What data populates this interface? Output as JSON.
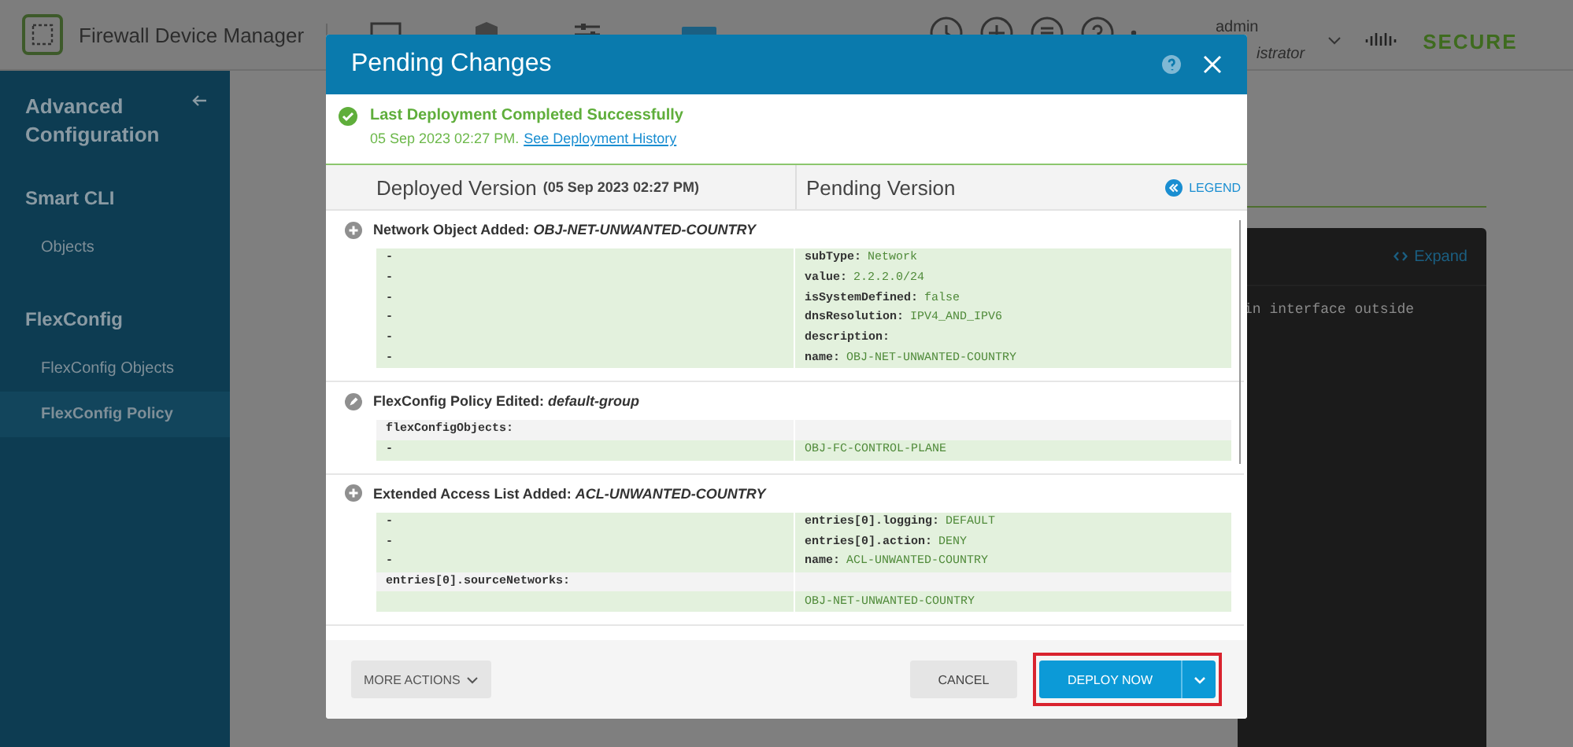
{
  "app": {
    "title": "Firewall Device Manager",
    "user": "admin",
    "role": "istrator",
    "brand": "SECURE"
  },
  "sidebar": {
    "title": "Advanced Configuration",
    "groups": [
      {
        "label": "Smart CLI",
        "items": [
          {
            "label": "Objects",
            "selected": false
          }
        ]
      },
      {
        "label": "FlexConfig",
        "items": [
          {
            "label": "FlexConfig Objects",
            "selected": false
          },
          {
            "label": "FlexConfig Policy",
            "selected": true
          }
        ]
      }
    ]
  },
  "background_panel": {
    "expand": "Expand",
    "code": "in interface outside"
  },
  "dialog": {
    "title": "Pending Changes",
    "status": {
      "title": "Last Deployment Completed Successfully",
      "date": "05 Sep 2023 02:27 PM.",
      "link": "See Deployment History"
    },
    "columns": {
      "deployed": "Deployed Version",
      "deployed_date": "(05 Sep 2023 02:27 PM)",
      "pending": "Pending Version",
      "legend": "LEGEND"
    },
    "sections": [
      {
        "kind": "added",
        "label": "Network Object Added:",
        "name": "OBJ-NET-UNWANTED-COUNTRY",
        "rows": [
          {
            "kind": "added",
            "left": "-",
            "key": "subType:",
            "value": "Network"
          },
          {
            "kind": "added",
            "left": "-",
            "key": "value:",
            "value": "2.2.2.0/24"
          },
          {
            "kind": "added",
            "left": "-",
            "key": "isSystemDefined:",
            "value": "false"
          },
          {
            "kind": "added",
            "left": "-",
            "key": "dnsResolution:",
            "value": "IPV4_AND_IPV6"
          },
          {
            "kind": "added",
            "left": "-",
            "key": "description:",
            "value": ""
          },
          {
            "kind": "added",
            "left": "-",
            "key": "name:",
            "value": "OBJ-NET-UNWANTED-COUNTRY"
          }
        ]
      },
      {
        "kind": "edited",
        "label": "FlexConfig Policy Edited:",
        "name": "default-group",
        "rows": [
          {
            "kind": "header",
            "left": "flexConfigObjects:",
            "key": "",
            "value": ""
          },
          {
            "kind": "added",
            "left": "-",
            "key": "",
            "value": "OBJ-FC-CONTROL-PLANE"
          }
        ]
      },
      {
        "kind": "added",
        "label": "Extended Access List Added:",
        "name": "ACL-UNWANTED-COUNTRY",
        "rows": [
          {
            "kind": "added",
            "left": "-",
            "key": "entries[0].logging:",
            "value": "DEFAULT"
          },
          {
            "kind": "added",
            "left": "-",
            "key": "entries[0].action:",
            "value": "DENY"
          },
          {
            "kind": "added",
            "left": "-",
            "key": "name:",
            "value": "ACL-UNWANTED-COUNTRY"
          },
          {
            "kind": "header",
            "left": "entries[0].sourceNetworks:",
            "key": "",
            "value": ""
          },
          {
            "kind": "added",
            "left": "",
            "key": "",
            "value": "OBJ-NET-UNWANTED-COUNTRY"
          }
        ]
      }
    ],
    "buttons": {
      "more": "MORE ACTIONS",
      "cancel": "CANCEL",
      "deploy": "DEPLOY NOW"
    }
  }
}
